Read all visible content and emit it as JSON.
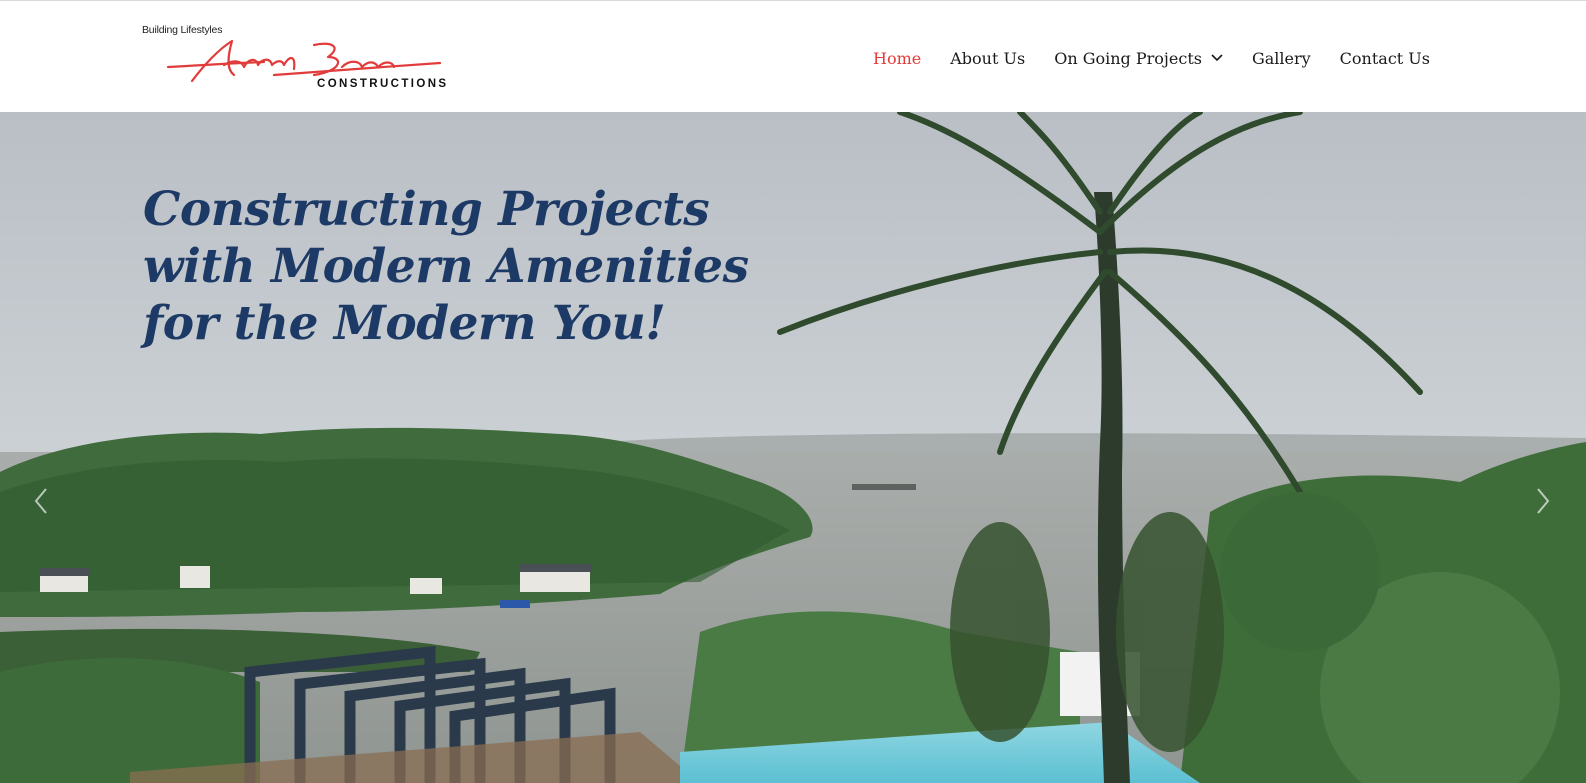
{
  "brand": {
    "tagline": "Building Lifestyles",
    "script_name": "Anand Bose",
    "company": "CONSTRUCTIONS",
    "accent_color": "#e23b3b"
  },
  "nav": {
    "items": [
      {
        "label": "Home",
        "active": true
      },
      {
        "label": "About Us",
        "active": false
      },
      {
        "label": "On Going Projects",
        "active": false,
        "has_dropdown": true
      },
      {
        "label": "Gallery",
        "active": false
      },
      {
        "label": "Contact Us",
        "active": false
      }
    ],
    "text_color": "#1a1a1a"
  },
  "hero": {
    "heading_lines": [
      "Constructing Projects",
      "with Modern Amenities",
      "for the Modern You!"
    ],
    "heading_color": "#1d3a66",
    "prev_icon": "chevron-left-icon",
    "next_icon": "chevron-right-icon"
  }
}
